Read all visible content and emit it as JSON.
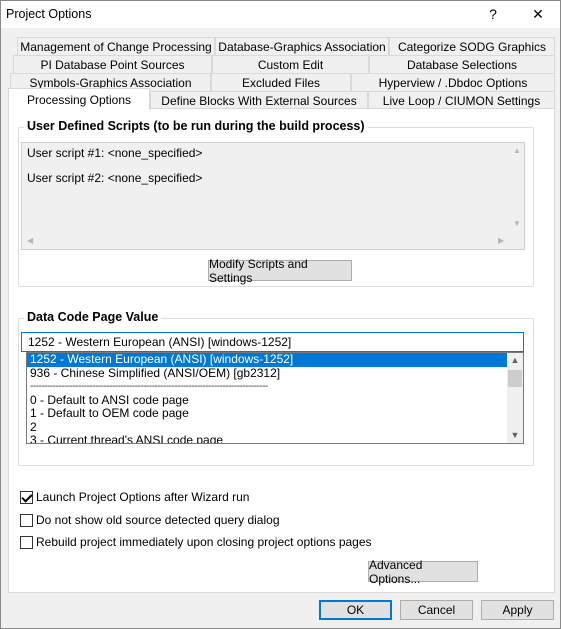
{
  "window": {
    "title": "Project Options",
    "help_glyph": "?",
    "close_glyph": "✕"
  },
  "tabs": {
    "row1": [
      "Management of Change Processing",
      "Database-Graphics Association",
      "Categorize SODG Graphics"
    ],
    "row2": [
      "PI Database Point Sources",
      "Custom Edit",
      "Database Selections"
    ],
    "row3": [
      "Symbols-Graphics Association",
      "Excluded Files",
      "Hyperview / .Dbdoc Options"
    ],
    "row4": [
      "Processing Options",
      "Define Blocks With External Sources",
      "Live Loop / CIUMON Settings"
    ],
    "active": "Processing Options"
  },
  "scripts": {
    "group_title": "User Defined Scripts (to be run during the build process)",
    "script1": "User script #1: <none_specified>",
    "script2": "User script #2: <none_specified>",
    "modify_button": "Modify Scripts and Settings"
  },
  "codepage": {
    "group_title": "Data Code Page Value",
    "current_value": "1252 - Western European (ANSI) [windows-1252]",
    "options": [
      "1252 - Western European (ANSI) [windows-1252]",
      "936 - Chinese Simplified (ANSI/OEM) [gb2312]",
      "------------------------------------------------------------------------------------",
      "0 - Default to ANSI code page",
      "1 - Default to OEM code page",
      "2",
      "3 - Current thread's ANSI code page"
    ],
    "selected_index": 0
  },
  "checkboxes": [
    {
      "label": "Launch Project Options after Wizard run",
      "checked": true
    },
    {
      "label": "Do not show old source detected query dialog",
      "checked": false
    },
    {
      "label": "Rebuild project immediately upon closing project options pages",
      "checked": false
    }
  ],
  "advanced_button": "Advanced Options...",
  "footer": {
    "ok": "OK",
    "cancel": "Cancel",
    "apply": "Apply"
  },
  "colors": {
    "accent": "#0078d7",
    "window_bg": "#f0f0f0",
    "panel_bg": "#ffffff"
  }
}
